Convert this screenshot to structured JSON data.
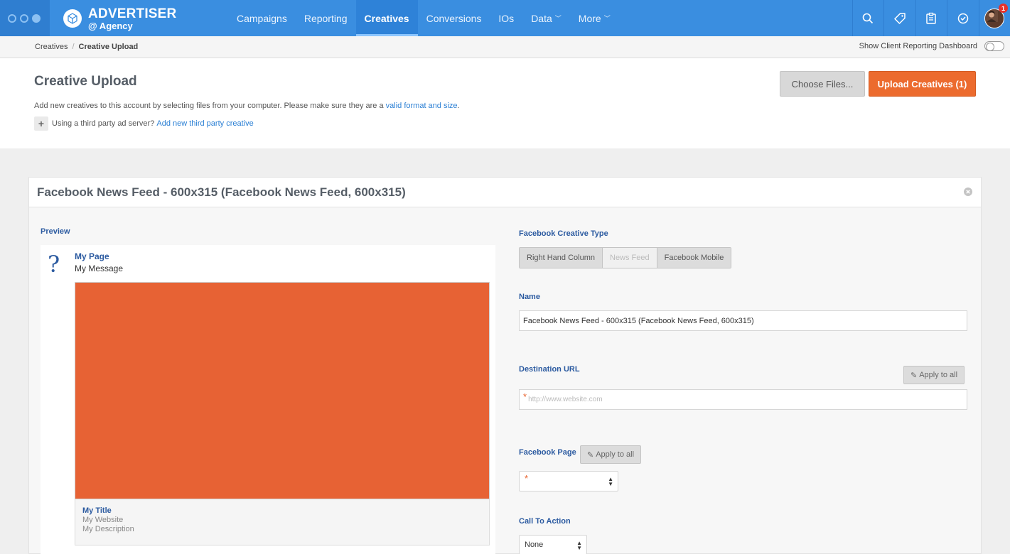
{
  "brand": {
    "title": "ADVERTISER",
    "subtitle": "@ Agency"
  },
  "nav": {
    "items": [
      {
        "label": "Campaigns"
      },
      {
        "label": "Reporting"
      },
      {
        "label": "Creatives",
        "active": true
      },
      {
        "label": "Conversions"
      },
      {
        "label": "IOs"
      },
      {
        "label": "Data",
        "caret": "﹀"
      },
      {
        "label": "More",
        "caret": "﹀"
      }
    ],
    "icons": [
      "search-icon",
      "tag-icon",
      "clipboard-icon",
      "clock-check-icon",
      "avatar"
    ],
    "notification_count": "1"
  },
  "breadcrumb": {
    "root": "Creatives",
    "separator": "/",
    "current": "Creative Upload"
  },
  "client_toggle": {
    "label": "Show Client Reporting Dashboard",
    "on": false
  },
  "header": {
    "title": "Creative Upload",
    "description_prefix": "Add new creatives to this account by selecting files from your computer. Please make sure they are a ",
    "description_link": "valid format and size",
    "description_suffix": ".",
    "third_party_prefix": "Using a third party ad server? ",
    "third_party_link": "Add new third party creative",
    "choose_files_label": "Choose Files...",
    "upload_label": "Upload Creatives (1)"
  },
  "card": {
    "title": "Facebook News Feed - 600x315 (Facebook News Feed, 600x315)",
    "preview": {
      "label": "Preview",
      "page": "My Page",
      "message": "My Message",
      "image_color": "#e76234",
      "title": "My Title",
      "website": "My Website",
      "description": "My Description"
    },
    "form": {
      "creative_type_label": "Facebook Creative Type",
      "creative_types": [
        {
          "label": "Right Hand Column",
          "active": false
        },
        {
          "label": "News Feed",
          "active": true
        },
        {
          "label": "Facebook Mobile",
          "active": false
        }
      ],
      "name_label": "Name",
      "name_value": "Facebook News Feed - 600x315 (Facebook News Feed, 600x315)",
      "destination_label": "Destination URL",
      "destination_placeholder": "http://www.website.com",
      "apply_to_all": "Apply to all",
      "page_label": "Facebook Page",
      "page_value": "",
      "cta_label": "Call To Action",
      "cta_value": "None"
    }
  },
  "colors": {
    "nav_bg": "#3a8ee0",
    "accent_orange": "#ec6b2e",
    "label_blue": "#2b5aa0",
    "link_blue": "#2a7fd4"
  }
}
